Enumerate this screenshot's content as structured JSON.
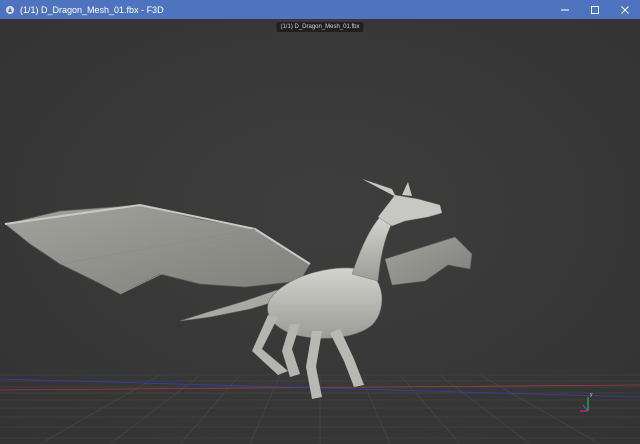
{
  "window": {
    "title": "(1/1) D_Dragon_Mesh_01.fbx - F3D",
    "controls": {
      "minimize_icon": "minimize-icon",
      "maximize_icon": "maximize-icon",
      "close_icon": "close-icon"
    }
  },
  "viewport": {
    "file_label": "(1/1) D_Dragon_Mesh_01.fbx",
    "background_color": "#3a3a3a",
    "model": "dragon-mesh",
    "grid": true,
    "axes_widget": true
  },
  "colors": {
    "titlebar": "#4f74bf",
    "mesh": "#bdbdb6",
    "grid_x_axis": "#a33b3b",
    "grid_z_axis": "#3b3bb3"
  }
}
